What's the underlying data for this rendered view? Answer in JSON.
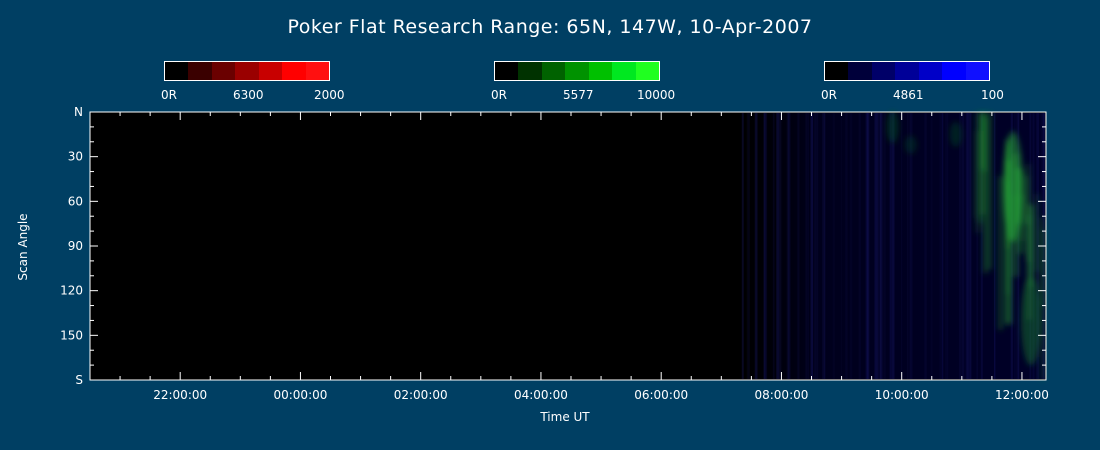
{
  "title": "Poker Flat Research Range: 65N, 147W, 10-Apr-2007",
  "colorbars": [
    {
      "name": "red",
      "labels": [
        "0R",
        "6300",
        "2000"
      ],
      "colors": [
        "#000000",
        "#3a0000",
        "#6a0000",
        "#9a0000",
        "#c80000",
        "#ff0000",
        "#ff1010"
      ]
    },
    {
      "name": "green",
      "labels": [
        "0R",
        "5577",
        "10000"
      ],
      "colors": [
        "#000000",
        "#003200",
        "#006200",
        "#009200",
        "#00c000",
        "#00e820",
        "#20ff20"
      ]
    },
    {
      "name": "blue",
      "labels": [
        "0R",
        "4861",
        "100"
      ],
      "colors": [
        "#000000",
        "#00003a",
        "#000068",
        "#000098",
        "#0000c8",
        "#0000ff",
        "#1010ff"
      ]
    }
  ],
  "chart_data": {
    "type": "heatmap",
    "xlabel": "Time UT",
    "ylabel": "Scan Angle",
    "x_ticks": [
      "22:00:00",
      "00:00:00",
      "02:00:00",
      "04:00:00",
      "06:00:00",
      "08:00:00",
      "10:00:00",
      "12:00:00"
    ],
    "x_range_hours": [
      20.5,
      36.4
    ],
    "y_ticks": [
      "N",
      "30",
      "60",
      "90",
      "120",
      "150",
      "S"
    ],
    "y_tick_values": [
      0,
      30,
      60,
      90,
      120,
      150,
      180
    ],
    "ylim": [
      0,
      180
    ],
    "features": [
      {
        "kind": "faint-blue-noise",
        "from_hours": 31.3,
        "to_hours": 36.4
      },
      {
        "kind": "green-emission",
        "from_hours": 33.6,
        "to_hours": 36.4,
        "peak_hours": 35.7,
        "angle_range": [
          0,
          180
        ]
      }
    ]
  }
}
